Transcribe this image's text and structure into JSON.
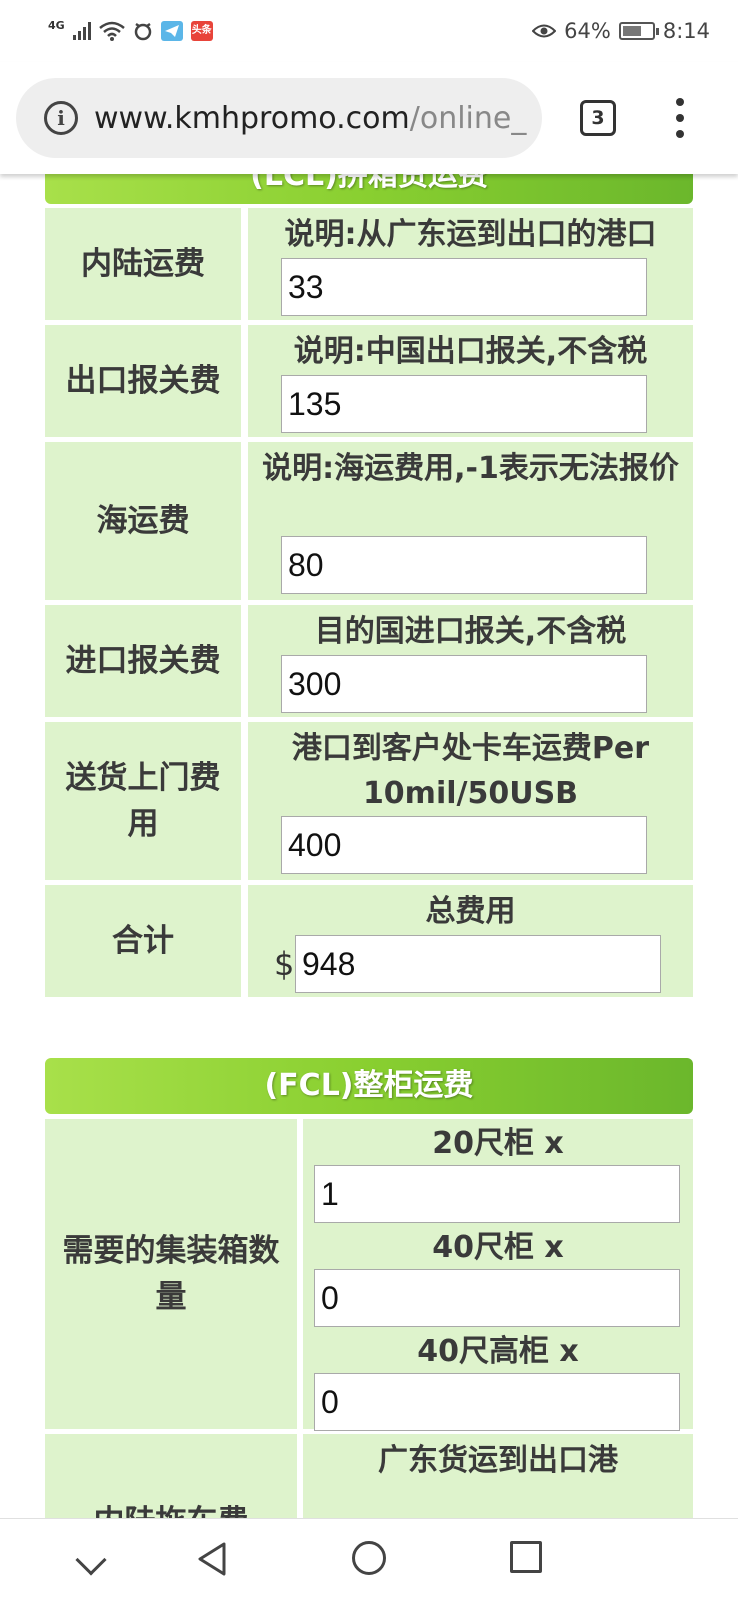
{
  "status_bar": {
    "network": "4G",
    "app_badge": "头条",
    "battery": "64%",
    "battery_level": 0.64,
    "time": "8:14"
  },
  "browser": {
    "url_domain": "www.kmhpromo.com",
    "url_path": "/online_",
    "tab_count": "3"
  },
  "lcl": {
    "title": "(LCL)拼箱货运费",
    "rows": [
      {
        "label": "内陆运费",
        "desc": "说明:从广东运到出口的港口",
        "value": "33"
      },
      {
        "label": "出口报关费",
        "desc": "说明:中国出口报关,不含税",
        "value": "135"
      },
      {
        "label": "海运费",
        "desc": "说明:海运费用,-1表示无法报价",
        "value": "80"
      },
      {
        "label": "进口报关费",
        "desc": "目的国进口报关,不含税",
        "value": "300"
      },
      {
        "label": "送货上门费用",
        "desc": "港口到客户处卡车运费Per 10mil/50USB",
        "value": "400"
      }
    ],
    "total": {
      "label": "合计",
      "desc": "总费用",
      "currency": "$",
      "value": "948"
    }
  },
  "fcl": {
    "title": "(FCL)整柜运费",
    "container_label": "需要的集装箱数量",
    "containers": [
      {
        "label": "20尺柜 x",
        "value": "1"
      },
      {
        "label": "40尺柜 x",
        "value": "0"
      },
      {
        "label": "40尺高柜 x",
        "value": "0"
      }
    ],
    "next_row": {
      "label": "内陆拖车费",
      "desc": "广东货运到出口港"
    }
  }
}
